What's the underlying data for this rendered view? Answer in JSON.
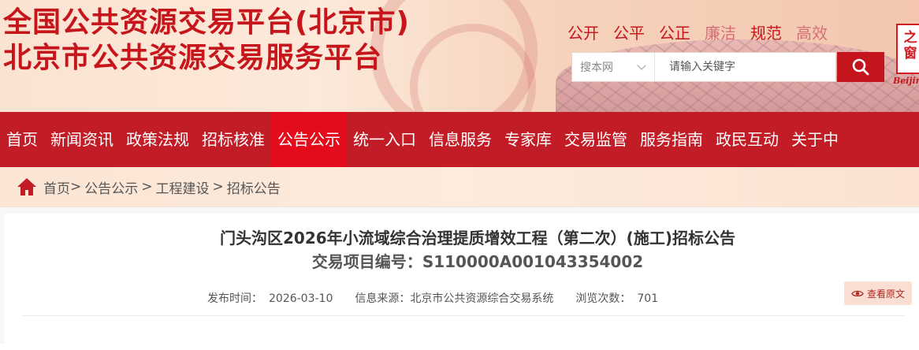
{
  "header": {
    "title": "全国公共资源交易平台(北京市)",
    "subtitle": "北京市公共资源交易服务平台",
    "slogans": [
      "公开",
      "公平",
      "公正",
      "廉洁",
      "规范",
      "高效"
    ],
    "logo_text": "之窗",
    "logo_caption": "Beijing",
    "search": {
      "scope": "搜本网",
      "placeholder": "请输入关键字"
    }
  },
  "nav": {
    "items": [
      {
        "label": "首页"
      },
      {
        "label": "新闻资讯"
      },
      {
        "label": "政策法规"
      },
      {
        "label": "招标核准"
      },
      {
        "label": "公告公示",
        "active": true
      },
      {
        "label": "统一入口"
      },
      {
        "label": "信息服务"
      },
      {
        "label": "专家库"
      },
      {
        "label": "交易监管"
      },
      {
        "label": "服务指南"
      },
      {
        "label": "政民互动"
      },
      {
        "label": "关于中"
      }
    ]
  },
  "breadcrumb": {
    "items": [
      "首页",
      "公告公示",
      "工程建设",
      "招标公告"
    ],
    "separators": [
      ">",
      ">",
      ">"
    ]
  },
  "article": {
    "title": "门头沟区2026年小流域综合治理提质增效工程（第二次）(施工)招标公告",
    "code_label": "交易项目编号：",
    "code": "S110000A001043354002",
    "meta": {
      "publish_label": "发布时间：",
      "publish_value": "2026-03-10",
      "source_label": "信息来源：",
      "source_value": "北京市公共资源综合交易系统",
      "views_label": "浏览次数：",
      "views_value": "701"
    },
    "view_original_label": "查看原文"
  },
  "colors": {
    "brand_red": "#c6161c",
    "nav_bg": "#c21c26",
    "nav_active": "#e40b1d"
  }
}
